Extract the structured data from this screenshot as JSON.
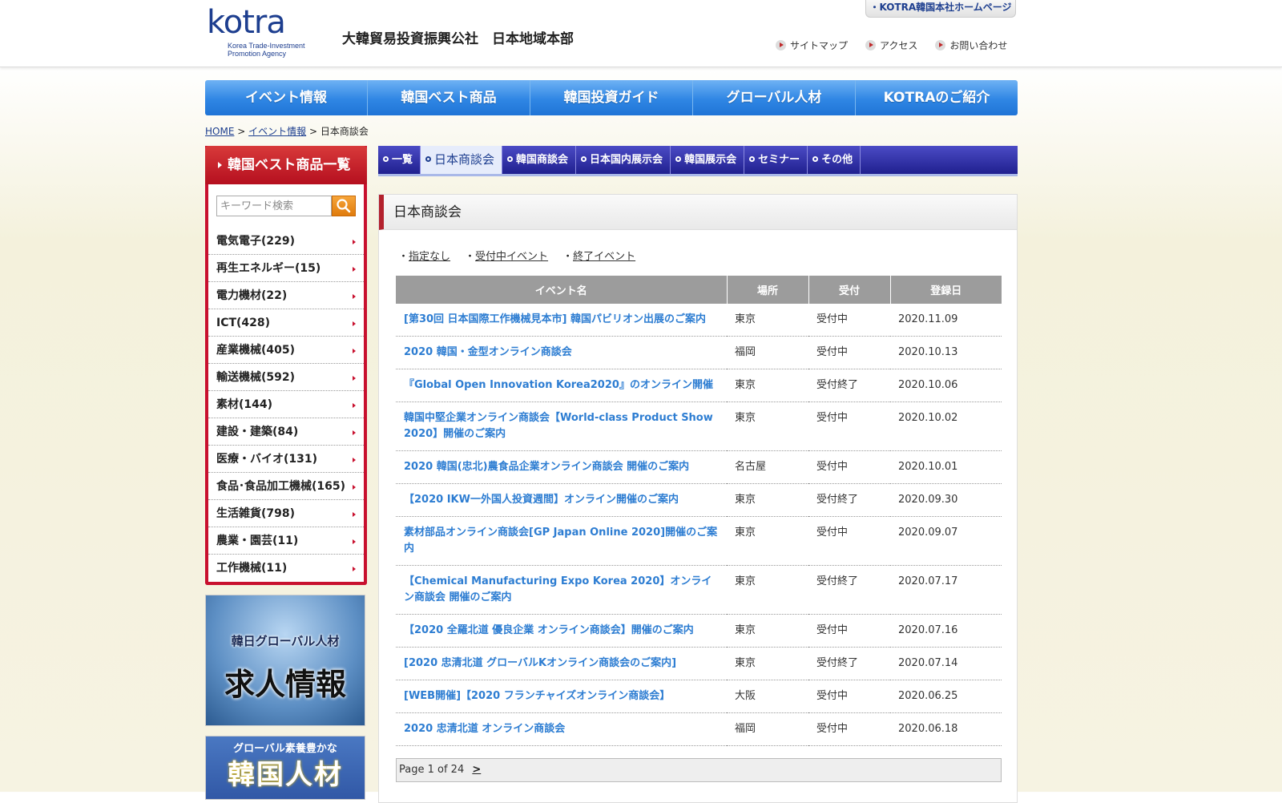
{
  "header": {
    "logo_word": "kotra",
    "logo_sub_line1": "Korea Trade-Investment",
    "logo_sub_line2": "Promotion Agency",
    "org_name": "大韓貿易投資振興公社　日本地域本部",
    "hq_link": "・KOTRA韓国本社ホームページ",
    "util": [
      "サイトマップ",
      "アクセス",
      "お問い合わせ"
    ]
  },
  "main_nav": [
    "イベント情報",
    "韓国ベスト商品",
    "韓国投資ガイド",
    "グローバル人材",
    "KOTRAのご紹介"
  ],
  "breadcrumb": {
    "home": "HOME",
    "sep1": ">",
    "events": "イベント情報",
    "sep2": ">",
    "current": "日本商談会"
  },
  "sidebar": {
    "title": "韓国ベスト商品一覧",
    "search_placeholder": "キーワード検索",
    "categories": [
      "電気電子(229)",
      "再生エネルギー(15)",
      "電力機材(22)",
      "ICT(428)",
      "産業機械(405)",
      "輸送機械(592)",
      "素材(144)",
      "建設・建築(84)",
      "医療・バイオ(131)",
      "食品･食品加工機械(165)",
      "生活雑貨(798)",
      "農業・園芸(11)",
      "工作機械(11)"
    ],
    "banner1_small": "韓日グローバル人材",
    "banner1_large": "求人情報",
    "banner2_small": "グローバル素養豊かな",
    "banner2_large": "韓国人材"
  },
  "sub_tabs": [
    "一覧",
    "日本商談会",
    "韓国商談会",
    "日本国内展示会",
    "韓国展示会",
    "セミナー",
    "その他"
  ],
  "content": {
    "title": "日本商談会",
    "filters": [
      "指定なし",
      "受付中イベント",
      "終了イベント"
    ],
    "columns": [
      "イベント名",
      "場所",
      "受付",
      "登録日"
    ],
    "rows": [
      [
        "[第30回 日本国際工作機械見本市] 韓国パビリオン出展のご案内",
        "東京",
        "受付中",
        "2020.11.09"
      ],
      [
        "2020 韓国・金型オンライン商談会",
        "福岡",
        "受付中",
        "2020.10.13"
      ],
      [
        "『Global Open Innovation Korea2020』のオンライン開催",
        "東京",
        "受付終了",
        "2020.10.06"
      ],
      [
        "韓国中堅企業オンライン商談会【World-class Product Show 2020】開催のご案内",
        "東京",
        "受付中",
        "2020.10.02"
      ],
      [
        "2020 韓国(忠北)農食品企業オンライン商談会 開催のご案内",
        "名古屋",
        "受付中",
        "2020.10.01"
      ],
      [
        "【2020 IKW一外国人投資週間】オンライン開催のご案内",
        "東京",
        "受付終了",
        "2020.09.30"
      ],
      [
        "素材部品オンライン商談会[GP Japan Online 2020]開催のご案内",
        "東京",
        "受付中",
        "2020.09.07"
      ],
      [
        "【Chemical Manufacturing Expo Korea 2020】オンライン商談会 開催のご案内",
        "東京",
        "受付終了",
        "2020.07.17"
      ],
      [
        "【2020 全羅北道 優良企業 オンライン商談会】開催のご案内",
        "東京",
        "受付中",
        "2020.07.16"
      ],
      [
        "[2020 忠清北道 グローバルKオンライン商談会のご案内]",
        "東京",
        "受付終了",
        "2020.07.14"
      ],
      [
        "[WEB開催]【2020 フランチャイズオンライン商談会】",
        "大阪",
        "受付中",
        "2020.06.25"
      ],
      [
        "2020 忠清北道 オンライン商談会",
        "福岡",
        "受付中",
        "2020.06.18"
      ]
    ],
    "pager_text": "Page 1 of 24",
    "pager_next": ">"
  }
}
